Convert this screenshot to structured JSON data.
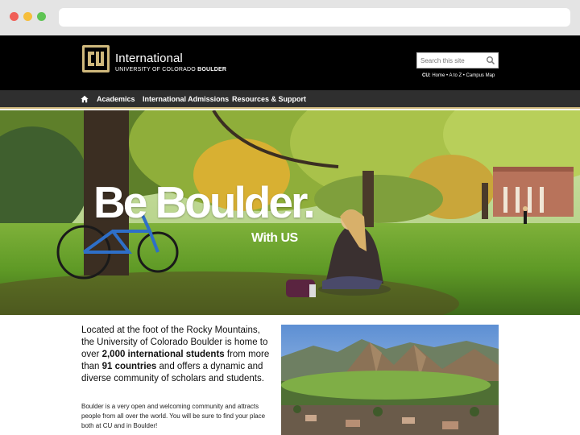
{
  "browser": {
    "url": ""
  },
  "header": {
    "logo_mark": "CU",
    "logo_title": "International",
    "logo_subtitle_prefix": "UNIVERSITY OF COLORADO ",
    "logo_subtitle_bold": "BOULDER",
    "search_placeholder": "Search this site",
    "util_prefix": "CU:",
    "util_links": "Home • A to Z • Campus Map"
  },
  "nav": {
    "items": [
      {
        "label": "Academics"
      },
      {
        "label": "International Admissions"
      },
      {
        "label": "Resources & Support"
      }
    ]
  },
  "hero": {
    "title": "Be Boulder.",
    "subtitle": "With US"
  },
  "intro": {
    "p1_a": "Located at the foot of the Rocky Mountains, the University of Colorado Boulder is home to over ",
    "p1_b": "2,000 international students",
    "p1_c": " from more than ",
    "p1_d": "91 countries",
    "p1_e": " and offers a dynamic and diverse community of scholars and students.",
    "p2": "Boulder is a very open and welcoming community and attracts people from all over the world. You will be sure to find your place both at CU and in Boulder!"
  },
  "colors": {
    "gold": "#cfb87c",
    "header_bg": "#000000",
    "nav_bg": "#2f2f2f"
  },
  "icons": {
    "search": "search-icon",
    "home": "home-icon"
  }
}
